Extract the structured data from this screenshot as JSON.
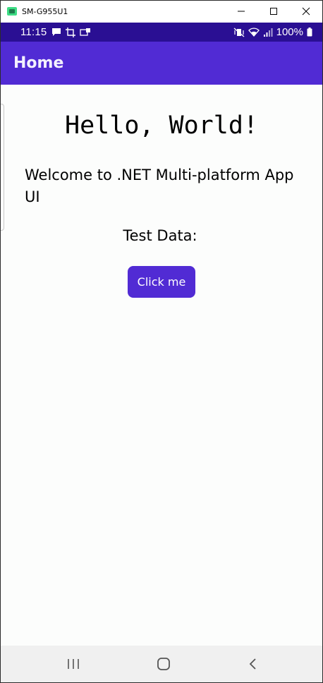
{
  "window": {
    "title": "SM-G955U1",
    "controls": {
      "minimize_icon": "minimize-icon",
      "maximize_icon": "maximize-icon",
      "close_icon": "close-icon"
    }
  },
  "status_bar": {
    "time": "11:15",
    "battery_percent": "100%",
    "background_color": "#2a0f93"
  },
  "app_bar": {
    "title": "Home",
    "background_color": "#512bd4"
  },
  "main": {
    "headline": "Hello, World!",
    "welcome_text": "Welcome to .NET Multi-platform App UI",
    "test_data_label": "Test Data:",
    "click_button_label": "Click me",
    "accent_color": "#512bd4"
  },
  "nav_bar": {
    "recents_icon": "recents-icon",
    "home_icon": "home-icon",
    "back_icon": "back-icon"
  }
}
